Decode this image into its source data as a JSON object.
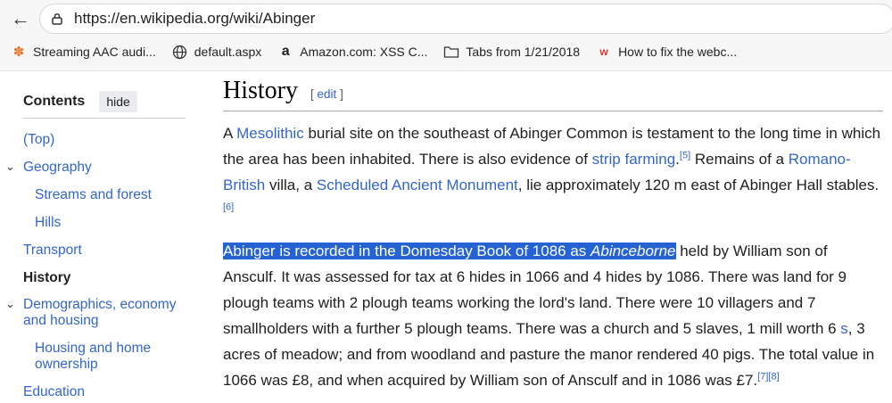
{
  "browser": {
    "url": "https://en.wikipedia.org/wiki/Abinger",
    "bookmarks": [
      {
        "label": "Streaming AAC audi...",
        "icon": "feed-icon"
      },
      {
        "label": "default.aspx",
        "icon": "globe-icon"
      },
      {
        "label": "Amazon.com: XSS C...",
        "icon": "amazon-icon"
      },
      {
        "label": "Tabs from 1/21/2018",
        "icon": "folder-icon"
      },
      {
        "label": "How to fix the webc...",
        "icon": "w-icon"
      }
    ]
  },
  "toc": {
    "title": "Contents",
    "hide_label": "hide",
    "items": [
      {
        "label": "(Top)"
      },
      {
        "label": "Geography"
      },
      {
        "label": "Streams and forest"
      },
      {
        "label": "Hills"
      },
      {
        "label": "Transport"
      },
      {
        "label": "History"
      },
      {
        "label": "Demographics, economy and housing"
      },
      {
        "label": "Housing and home ownership"
      },
      {
        "label": "Education"
      }
    ]
  },
  "article": {
    "heading": "History",
    "edit_open": "[",
    "edit_label": "edit",
    "edit_close": "]",
    "p1": {
      "t1": "A ",
      "l1": "Mesolithic",
      "t2": " burial site on the southeast of Abinger Common is testament to the long time in which the area has been inhabited. There is also evidence of ",
      "l2": "strip farming",
      "t3": ".",
      "r1": "[5]",
      "t4": " Remains of a ",
      "l3": "Romano-British",
      "t5": " villa, a ",
      "l4": "Scheduled Ancient Monument",
      "t6": ", lie approximately 120 m east of Abinger Hall stables.",
      "r2": "[6]"
    },
    "p2": {
      "sel1": "Abinger is recorded in the Domesday Book of 1086 as ",
      "sel_italic": "Abinceborne",
      "t1": " held by William son of Ansculf. It was assessed for tax at 6 hides in 1066 and 4 hides by 1086. There was land for 9 plough teams with 2 plough teams working the lord's land. There were 10 villagers and 7 smallholders with a further 5 plough teams. There was a church and 5 slaves, 1 mill worth 6 ",
      "l1": "s",
      "t2": ", 3 acres of meadow; and from woodland and pasture the manor rendered 40 pigs. The total value in 1066 was £8, and when acquired by William son of Ansculf and in 1086 was £7.",
      "r1": "[7]",
      "r2": "[8]"
    }
  }
}
